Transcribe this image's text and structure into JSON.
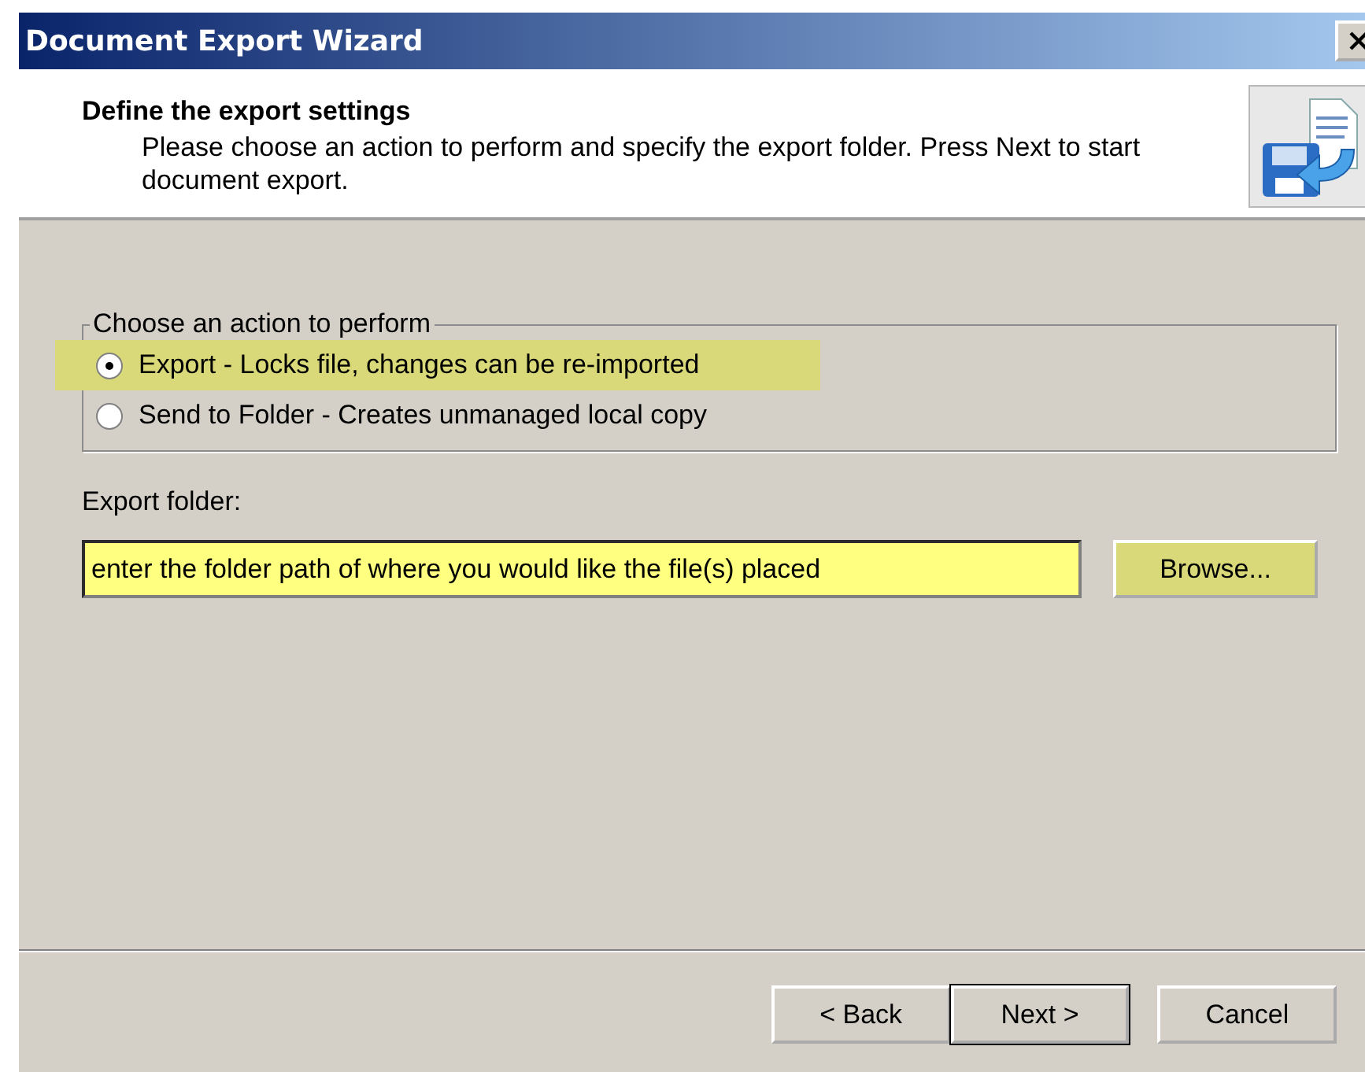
{
  "window": {
    "title": "Document Export Wizard"
  },
  "header": {
    "title": "Define the export settings",
    "description": "Please choose an action to perform and specify the export folder. Press Next to start document export."
  },
  "action_group": {
    "label": "Choose an action to perform",
    "options": [
      {
        "label": "Export - Locks file, changes can be re-imported",
        "selected": true,
        "highlighted": true
      },
      {
        "label": "Send to Folder - Creates unmanaged local copy",
        "selected": false,
        "highlighted": false
      }
    ]
  },
  "export_folder": {
    "label": "Export folder:",
    "value": "enter the folder path of where you would like the file(s) placed",
    "highlighted": true,
    "browse_button": {
      "label": "Browse...",
      "highlighted": true
    }
  },
  "buttons": [
    {
      "label": "< Back",
      "default": false
    },
    {
      "label": "Next >",
      "default": true
    },
    {
      "label": "Cancel",
      "default": false
    }
  ]
}
